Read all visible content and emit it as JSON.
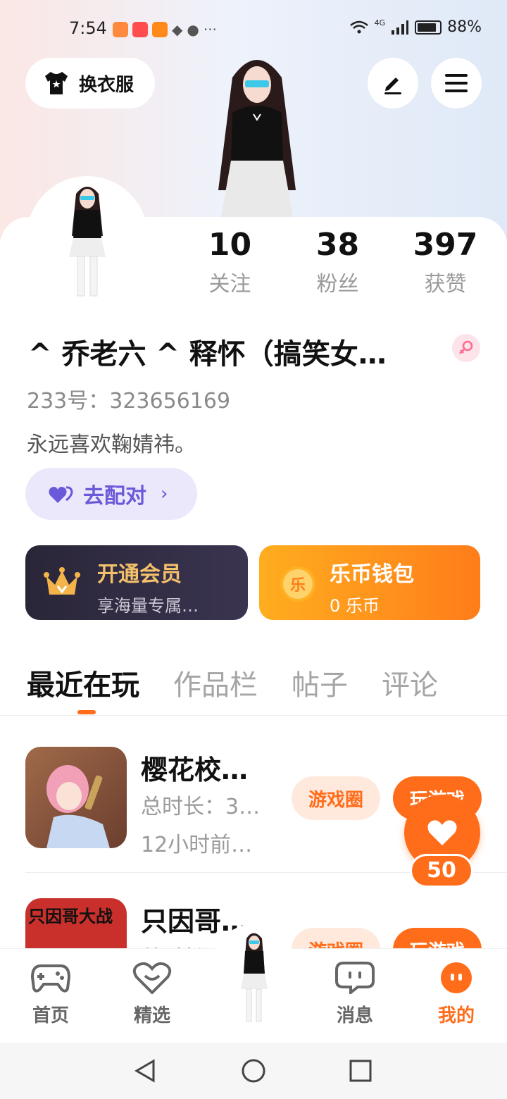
{
  "status_bar": {
    "time": "7:54",
    "battery": "88%",
    "network": "4G"
  },
  "header": {
    "outfit_label": "换衣服"
  },
  "stats": [
    {
      "value": "10",
      "label": "关注"
    },
    {
      "value": "38",
      "label": "粉丝"
    },
    {
      "value": "397",
      "label": "获赞"
    }
  ],
  "profile": {
    "username": "^ 乔老六 ^ 释怀（搞笑女…",
    "id_text": "233号：323656169",
    "bio": "永远喜欢鞠婧祎。"
  },
  "pair": {
    "label": "去配对"
  },
  "vip": {
    "title": "开通会员",
    "subtitle": "享海量专属…"
  },
  "wallet": {
    "title": "乐币钱包",
    "subtitle": "0 乐币",
    "coin_glyph": "乐"
  },
  "tabs": [
    "最近在玩",
    "作品栏",
    "帖子",
    "评论"
  ],
  "games": [
    {
      "title": "樱花校…",
      "meta": "总时长：3…",
      "time": "12小时前…",
      "circle_label": "游戏圈",
      "play_label": "玩游戏"
    },
    {
      "title": "只因哥…",
      "meta": "总时长…",
      "circle_label": "游戏圈",
      "play_label": "玩游戏",
      "thumb_text": "只因哥大战"
    }
  ],
  "like": {
    "count": "50"
  },
  "nav": [
    {
      "label": "首页",
      "icon": "gamepad-icon"
    },
    {
      "label": "精选",
      "icon": "heart-smile-icon"
    },
    {
      "label": "消息",
      "icon": "chat-icon"
    },
    {
      "label": "我的",
      "icon": "profile-icon"
    }
  ],
  "colors": {
    "accent": "#ff6d1a",
    "vip_gold": "#f4c16b",
    "pair_purple": "#6a59d8"
  }
}
